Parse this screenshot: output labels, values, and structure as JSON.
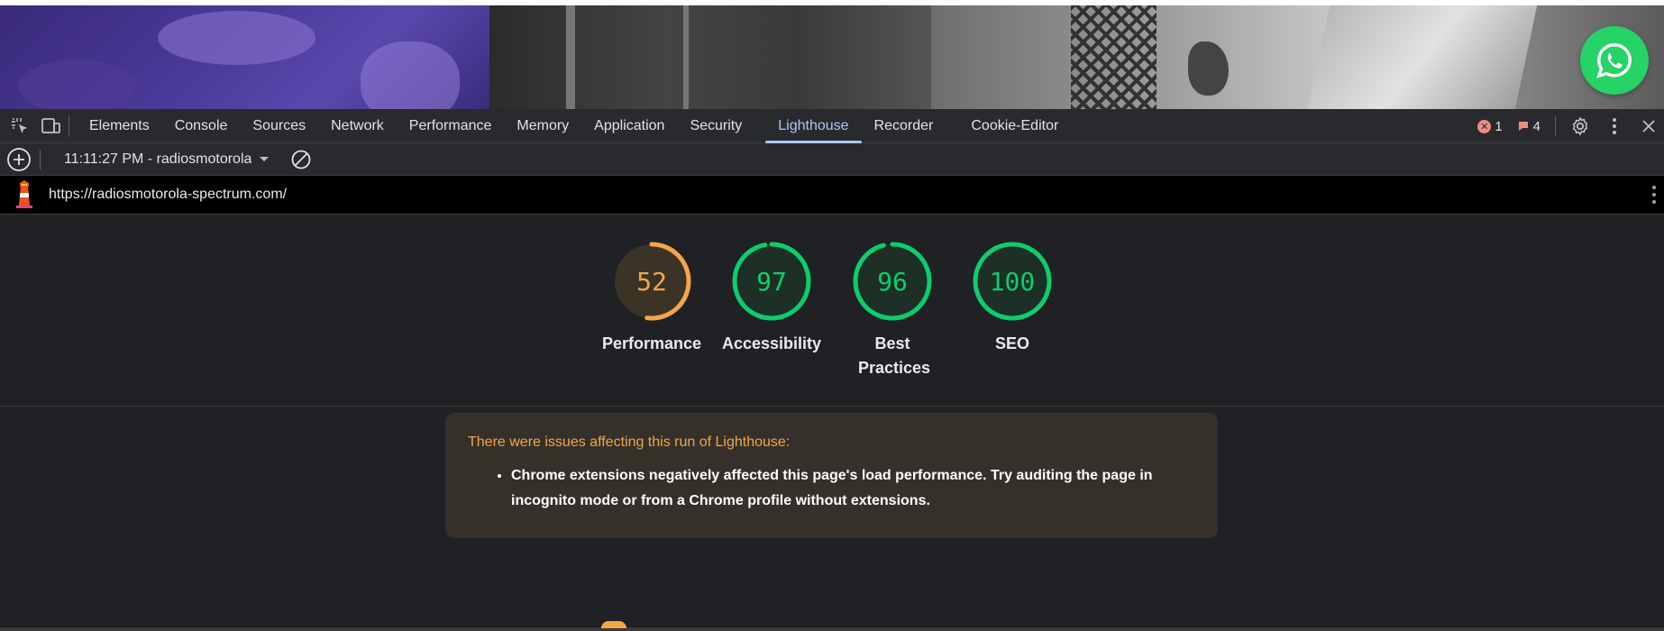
{
  "devtools": {
    "tabs": [
      {
        "label": "Elements",
        "active": false
      },
      {
        "label": "Console",
        "active": false
      },
      {
        "label": "Sources",
        "active": false
      },
      {
        "label": "Network",
        "active": false
      },
      {
        "label": "Performance",
        "active": false
      },
      {
        "label": "Memory",
        "active": false
      },
      {
        "label": "Application",
        "active": false
      },
      {
        "label": "Security",
        "active": false
      },
      {
        "label": "Lighthouse",
        "active": true
      },
      {
        "label": "Recorder",
        "active": false
      },
      {
        "label": "Cookie-Editor",
        "active": false
      }
    ],
    "error_count": "1",
    "issue_count": "4"
  },
  "report": {
    "run_label": "11:11:27 PM - radiosmotorola-spectrum.com",
    "url": "https://radiosmotorola-spectrum.com/"
  },
  "scores": [
    {
      "label": "Performance",
      "value": 52,
      "color": "#f5a54a",
      "bg": "#3b3325"
    },
    {
      "label": "Accessibility",
      "value": 97,
      "color": "#0cce6b",
      "bg": "#1e3026"
    },
    {
      "label": "Best Practices",
      "value": 96,
      "color": "#0cce6b",
      "bg": "#1e3026"
    },
    {
      "label": "SEO",
      "value": 100,
      "color": "#0cce6b",
      "bg": "#1e3026"
    }
  ],
  "warning": {
    "title": "There were issues affecting this run of Lighthouse:",
    "items": [
      "Chrome extensions negatively affected this page's load performance. Try auditing the page in incognito mode or from a Chrome profile without extensions."
    ]
  },
  "icons": {
    "whatsapp": "whatsapp-icon",
    "inspect": "inspect-element-icon",
    "device": "device-toolbar-icon",
    "settings": "gear-icon",
    "more": "more-vertical-icon",
    "close": "close-icon",
    "add": "add-report-icon",
    "clear": "clear-icon",
    "lighthouse": "lighthouse-icon"
  }
}
